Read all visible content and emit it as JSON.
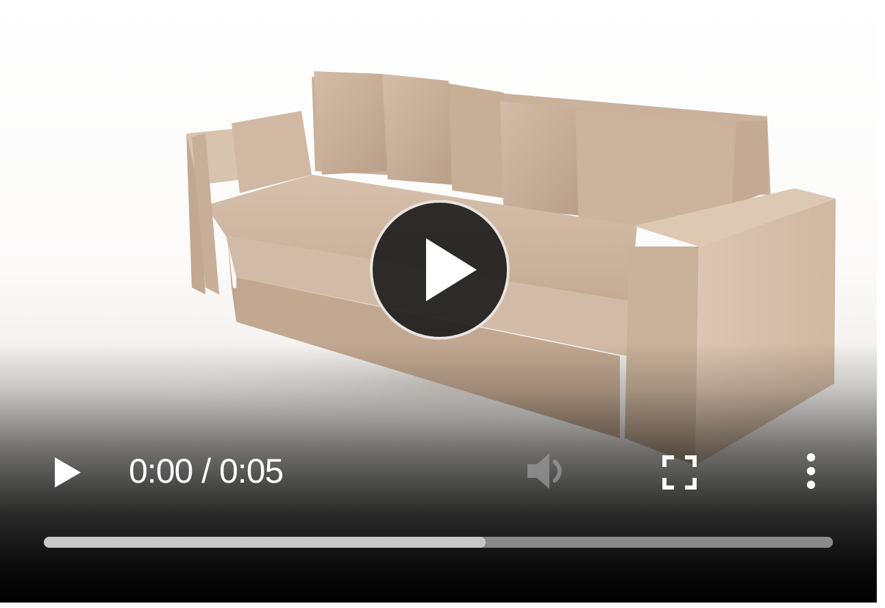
{
  "player": {
    "time_display": "0:00 / 0:05",
    "buffered_fraction": 0.56,
    "played_fraction": 0.0,
    "muted": true,
    "icons": {
      "big_play": "play-circle-icon",
      "play": "play-icon",
      "mute": "volume-muted-icon",
      "fullscreen": "fullscreen-icon",
      "menu": "more-vertical-icon"
    },
    "colors": {
      "sofa": "#cbb39e",
      "control_text": "#ffffff",
      "progress_track": "#8a8a8a",
      "progress_buffer": "#c8c8c8",
      "big_play_bg": "#1e1e1e"
    }
  }
}
